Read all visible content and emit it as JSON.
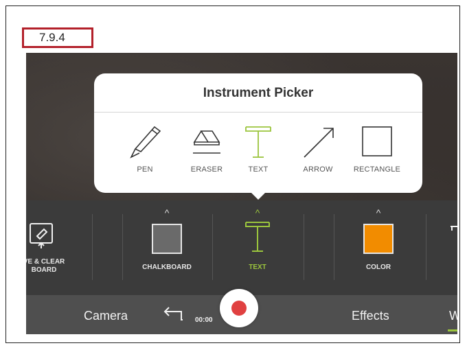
{
  "step_label": "7.9.4",
  "popover": {
    "title": "Instrument Picker",
    "tools": [
      {
        "label": "PEN",
        "icon": "pen-icon"
      },
      {
        "label": "ERASER",
        "icon": "eraser-icon"
      },
      {
        "label": "TEXT",
        "icon": "text-icon"
      },
      {
        "label": "ARROW",
        "icon": "arrow-icon"
      },
      {
        "label": "RECTANGLE",
        "icon": "rectangle-icon"
      }
    ]
  },
  "toolbar": {
    "save_clear_line1": "VE & CLEAR",
    "save_clear_line2": "BOARD",
    "chalkboard_label": "CHALKBOARD",
    "text_label": "TEXT",
    "color_label": "COLOR",
    "caret": "^"
  },
  "bottom_bar": {
    "camera": "Camera",
    "timer": "00:00",
    "effects": "Effects",
    "partial_tab": "W"
  },
  "colors": {
    "accent_green": "#9bc53d",
    "record_red": "#e04040",
    "color_swatch": "#f28c00",
    "chalkboard_swatch": "#6a6a6a"
  }
}
